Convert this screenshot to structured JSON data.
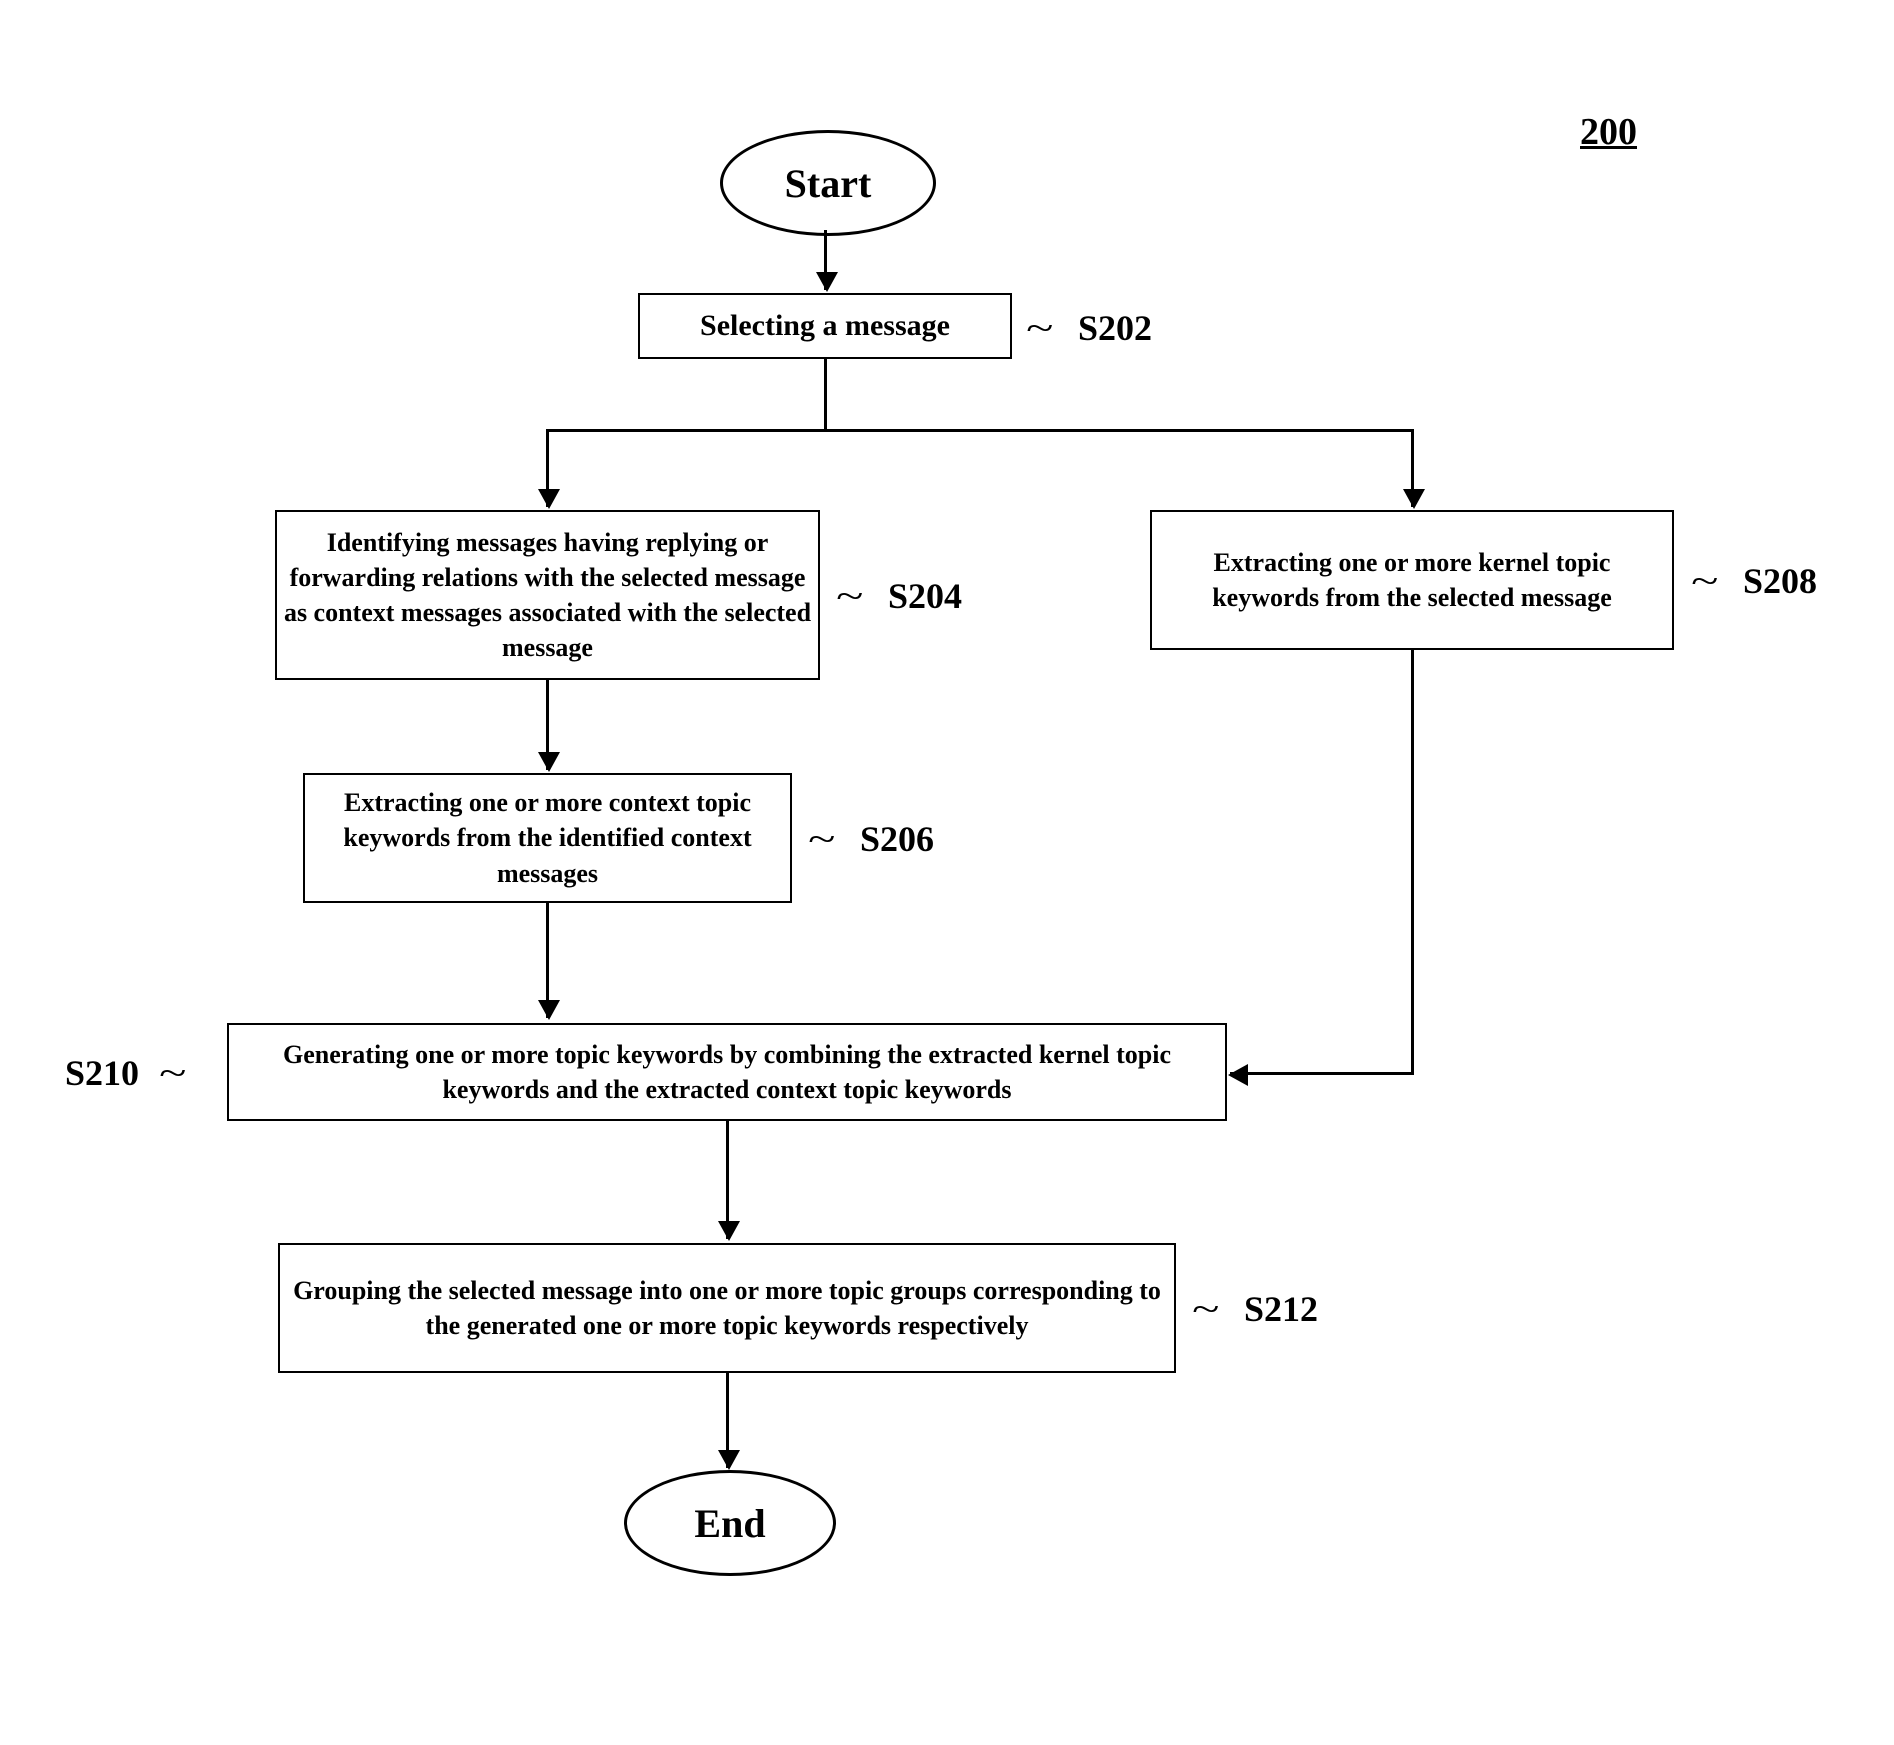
{
  "figure_label": "200",
  "start": "Start",
  "end": "End",
  "steps": {
    "s202": {
      "id": "S202",
      "text": "Selecting a message"
    },
    "s204": {
      "id": "S204",
      "text": "Identifying messages having replying or forwarding relations with the selected message as context messages associated with the selected message"
    },
    "s206": {
      "id": "S206",
      "text": "Extracting one or more context topic keywords from the identified context messages"
    },
    "s208": {
      "id": "S208",
      "text": "Extracting one or more kernel topic keywords from the selected message"
    },
    "s210": {
      "id": "S210",
      "text": "Generating one or more topic keywords by combining the extracted kernel topic keywords and the extracted context topic keywords"
    },
    "s212": {
      "id": "S212",
      "text": "Grouping the selected message into one or more topic groups corresponding to the generated one or more topic keywords respectively"
    }
  },
  "chart_data": {
    "type": "flowchart",
    "nodes": [
      {
        "id": "start",
        "kind": "terminal",
        "label": "Start"
      },
      {
        "id": "S202",
        "kind": "process",
        "label": "Selecting a message"
      },
      {
        "id": "S204",
        "kind": "process",
        "label": "Identifying messages having replying or forwarding relations with the selected message as context messages associated with the selected message"
      },
      {
        "id": "S206",
        "kind": "process",
        "label": "Extracting one or more context topic keywords from the identified context messages"
      },
      {
        "id": "S208",
        "kind": "process",
        "label": "Extracting one or more kernel topic keywords from the selected message"
      },
      {
        "id": "S210",
        "kind": "process",
        "label": "Generating one or more topic keywords by combining the extracted kernel topic keywords and the extracted context topic keywords"
      },
      {
        "id": "S212",
        "kind": "process",
        "label": "Grouping the selected message into one or more topic groups corresponding to the generated one or more topic keywords respectively"
      },
      {
        "id": "end",
        "kind": "terminal",
        "label": "End"
      }
    ],
    "edges": [
      {
        "from": "start",
        "to": "S202"
      },
      {
        "from": "S202",
        "to": "S204"
      },
      {
        "from": "S202",
        "to": "S208"
      },
      {
        "from": "S204",
        "to": "S206"
      },
      {
        "from": "S206",
        "to": "S210"
      },
      {
        "from": "S208",
        "to": "S210"
      },
      {
        "from": "S210",
        "to": "S212"
      },
      {
        "from": "S212",
        "to": "end"
      }
    ]
  }
}
